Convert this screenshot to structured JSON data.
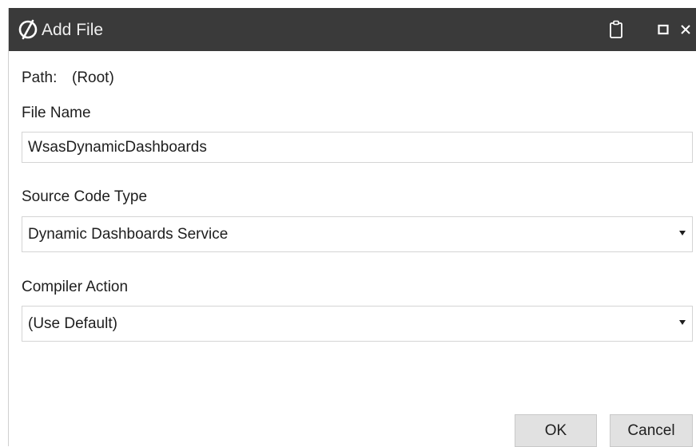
{
  "dialog": {
    "title": "Add File",
    "icons": {
      "logo": "app-logo-icon",
      "clipboard": "clipboard-icon",
      "maximize": "maximize-icon",
      "close": "close-icon"
    }
  },
  "path": {
    "label": "Path:",
    "value": "(Root)"
  },
  "file_name": {
    "label": "File Name",
    "value": "WsasDynamicDashboards"
  },
  "source_code_type": {
    "label": "Source Code Type",
    "selected": "Dynamic Dashboards Service"
  },
  "compiler_action": {
    "label": "Compiler Action",
    "selected": "(Use Default)"
  },
  "buttons": {
    "ok": "OK",
    "cancel": "Cancel"
  },
  "colors": {
    "titlebar": "#3a3a3a",
    "button_bg": "#e1e1e1",
    "field_border": "#d4d4d4"
  }
}
